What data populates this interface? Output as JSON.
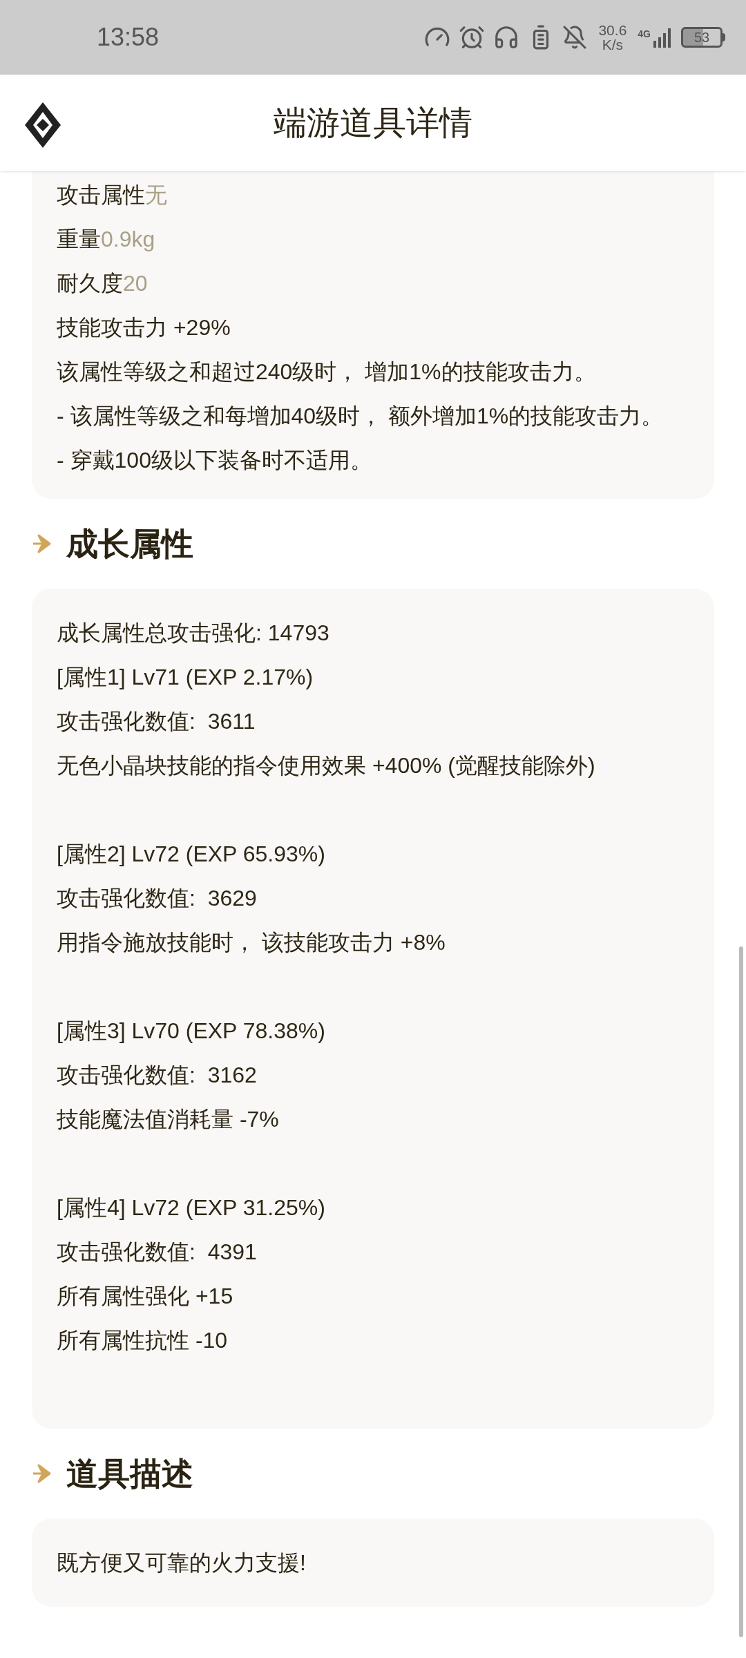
{
  "status_bar": {
    "time": "13:58",
    "net_speed": "30.6",
    "net_unit": "K/s",
    "network": "4G",
    "battery": "53"
  },
  "header": {
    "title": "端游道具详情"
  },
  "attributes": {
    "lines": [
      {
        "label": "攻击属性",
        "value": "无"
      },
      {
        "label": "重量",
        "value": "0.9kg"
      },
      {
        "label": "耐久度",
        "value": "20"
      },
      {
        "label": "技能攻击力 +29%"
      },
      {
        "label": "该属性等级之和超过240级时， 增加1%的技能攻击力。"
      },
      {
        "label": "- 该属性等级之和每增加40级时， 额外增加1%的技能攻击力。"
      },
      {
        "label": "- 穿戴100级以下装备时不适用。"
      }
    ]
  },
  "growth": {
    "title": "成长属性",
    "summary": "成长属性总攻击强化: 14793",
    "groups": [
      {
        "lines": [
          "[属性1] Lv71 (EXP 2.17%)",
          "攻击强化数值:  3611",
          "无色小晶块技能的指令使用效果 +400% (觉醒技能除外)"
        ]
      },
      {
        "lines": [
          "[属性2] Lv72 (EXP 65.93%)",
          "攻击强化数值:  3629",
          "用指令施放技能时， 该技能攻击力 +8%"
        ]
      },
      {
        "lines": [
          "[属性3] Lv70 (EXP 78.38%)",
          "攻击强化数值:  3162",
          "技能魔法值消耗量 -7%"
        ]
      },
      {
        "lines": [
          "[属性4] Lv72 (EXP 31.25%)",
          "攻击强化数值:  4391",
          "所有属性强化 +15",
          "所有属性抗性 -10"
        ]
      }
    ]
  },
  "description": {
    "title": "道具描述",
    "text": "既方便又可靠的火力支援!"
  }
}
